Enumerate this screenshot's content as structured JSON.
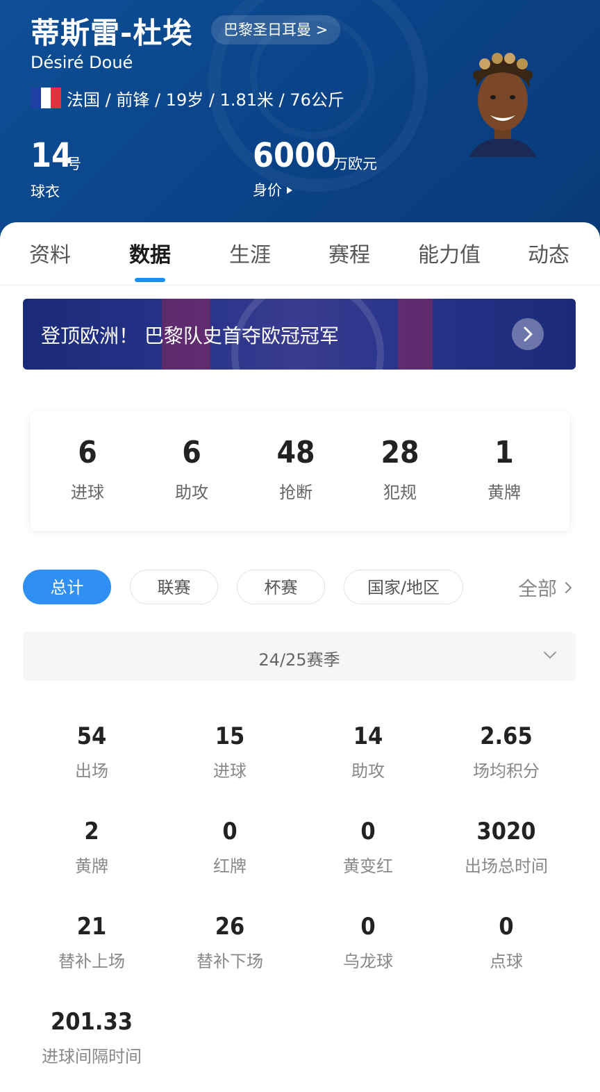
{
  "header": {
    "name_cn": "蒂斯雷-杜埃",
    "club_link": "巴黎圣日耳曼 >",
    "name_latin": "Désiré Doué",
    "meta": "法国 / 前锋 / 19岁 / 1.81米 / 76公斤",
    "jersey_number": "14",
    "jersey_unit": "号",
    "jersey_label": "球衣",
    "value": "6000",
    "value_unit": "万欧元",
    "value_label": "身价",
    "flag_colors": [
      "#1f3fa3",
      "#ffffff",
      "#e0323c"
    ]
  },
  "tabs": [
    "资料",
    "数据",
    "生涯",
    "赛程",
    "能力值",
    "动态"
  ],
  "active_tab": "数据",
  "banner": {
    "text": "登顶欧洲！ 巴黎队史首夺欧冠冠军"
  },
  "summary": [
    {
      "value": "6",
      "label": "进球"
    },
    {
      "value": "6",
      "label": "助攻"
    },
    {
      "value": "48",
      "label": "抢断"
    },
    {
      "value": "28",
      "label": "犯规"
    },
    {
      "value": "1",
      "label": "黄牌"
    }
  ],
  "filters": [
    "总计",
    "联赛",
    "杯赛",
    "国家/地区"
  ],
  "filter_all": "全部",
  "season": "24/25赛季",
  "stats": [
    {
      "value": "54",
      "label": "出场"
    },
    {
      "value": "15",
      "label": "进球"
    },
    {
      "value": "14",
      "label": "助攻"
    },
    {
      "value": "2.65",
      "label": "场均积分"
    },
    {
      "value": "2",
      "label": "黄牌"
    },
    {
      "value": "0",
      "label": "红牌"
    },
    {
      "value": "0",
      "label": "黄变红"
    },
    {
      "value": "3020",
      "label": "出场总时间"
    },
    {
      "value": "21",
      "label": "替补上场"
    },
    {
      "value": "26",
      "label": "替补下场"
    },
    {
      "value": "0",
      "label": "乌龙球"
    },
    {
      "value": "0",
      "label": "点球"
    },
    {
      "value": "201.33",
      "label": "进球间隔时间"
    }
  ],
  "colors": {
    "accent": "#2f8ff3",
    "header_bg": "#0a4286"
  }
}
